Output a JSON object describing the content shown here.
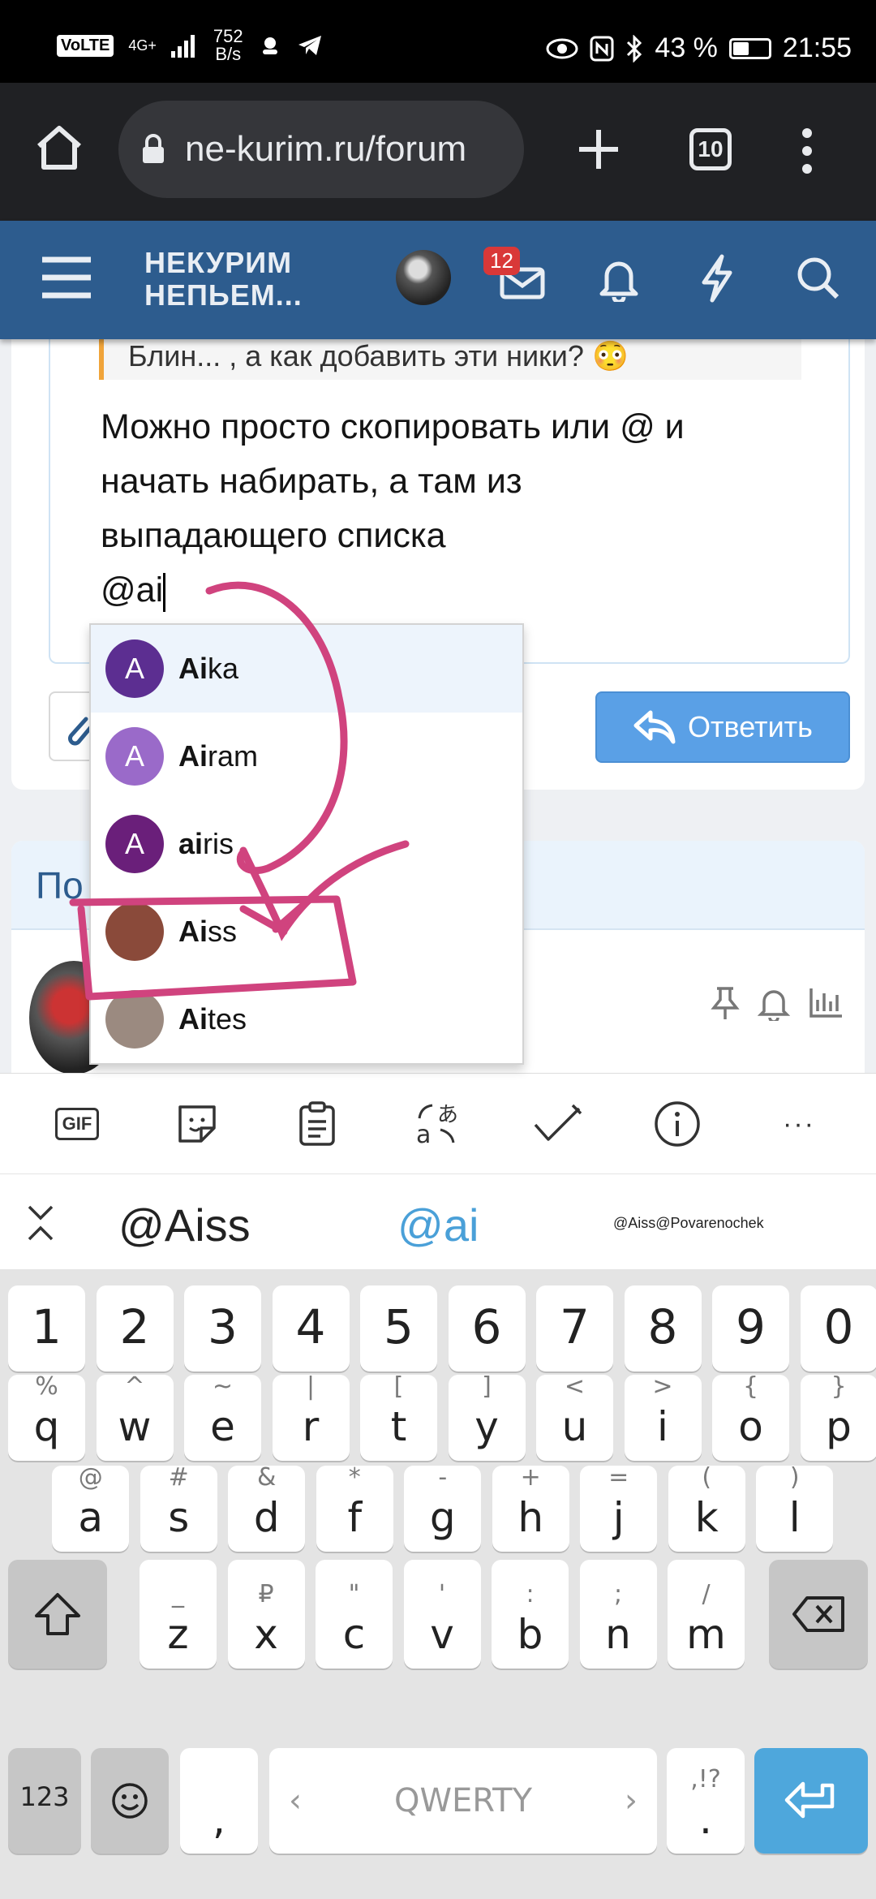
{
  "status_bar": {
    "volte": "VoLTE",
    "network": "4G+",
    "net_speed_value": "752",
    "net_speed_unit": "B/s",
    "battery_pct": "43 %",
    "battery_level": 0.43,
    "time": "21:55"
  },
  "browser": {
    "url": "ne-kurim.ru/forum",
    "tab_count": "10"
  },
  "forum": {
    "logo_line1": "НЕКУРИМ",
    "logo_line2": "НЕПЬЕМ...",
    "inbox_badge": "12"
  },
  "editor": {
    "quote_text": "Блин... , а как добавить эти ники? 😳",
    "line1": "Можно просто скопировать или @ и",
    "line2": "начать набирать, а там из",
    "line3": "выпадающего списка",
    "line4": "@ai"
  },
  "reply_button": "Ответить",
  "similar": {
    "heading": "По"
  },
  "mentions": [
    {
      "match": "Ai",
      "rest": "ka",
      "initial": "A",
      "color": "#5c2e91",
      "highlighted": true
    },
    {
      "match": "Ai",
      "rest": "ram",
      "initial": "A",
      "color": "#9a6ac9",
      "highlighted": false
    },
    {
      "match": "ai",
      "rest": "ris",
      "initial": "A",
      "color": "#6a1f7a",
      "highlighted": false
    },
    {
      "match": "Ai",
      "rest": "ss",
      "initial": "",
      "color": "#8a4a3a",
      "highlighted": false
    },
    {
      "match": "Ai",
      "rest": "tes",
      "initial": "",
      "color": "#9b8a80",
      "highlighted": false
    }
  ],
  "keyboard_toolbar": {
    "gif": "GIF",
    "more": "···"
  },
  "suggestions": {
    "first": "@Aiss",
    "second": "@ai",
    "third": "@Aiss@Povarenochek"
  },
  "keyboard": {
    "numbers": [
      "1",
      "2",
      "3",
      "4",
      "5",
      "6",
      "7",
      "8",
      "9",
      "0"
    ],
    "row1": [
      [
        "%",
        "q"
      ],
      [
        "^",
        "w"
      ],
      [
        "~",
        "e"
      ],
      [
        "|",
        "r"
      ],
      [
        "[",
        "t"
      ],
      [
        "]",
        "y"
      ],
      [
        "<",
        "u"
      ],
      [
        ">",
        "i"
      ],
      [
        "{",
        "o"
      ],
      [
        "}",
        "p"
      ]
    ],
    "row2": [
      [
        "@",
        "a"
      ],
      [
        "#",
        "s"
      ],
      [
        "&",
        "d"
      ],
      [
        "*",
        "f"
      ],
      [
        "-",
        "g"
      ],
      [
        "+",
        "h"
      ],
      [
        "=",
        "j"
      ],
      [
        "(",
        "k"
      ],
      [
        ")",
        "l"
      ]
    ],
    "row3": [
      [
        "_",
        "z"
      ],
      [
        "₽",
        "x"
      ],
      [
        "\"",
        "c"
      ],
      [
        "'",
        "v"
      ],
      [
        ":",
        "b"
      ],
      [
        ";",
        "n"
      ],
      [
        "/",
        "m"
      ]
    ],
    "sym_key": "123",
    "comma": ",",
    "space_label": "QWERTY",
    "space_left": "‹",
    "space_right": "›",
    "period_sub": ",!?",
    "period": "."
  },
  "colors": {
    "forum_header": "#2d5c8e",
    "reply_button": "#5aa0e6",
    "annotation": "#d0437e",
    "enter_key": "#4ea7dc"
  }
}
